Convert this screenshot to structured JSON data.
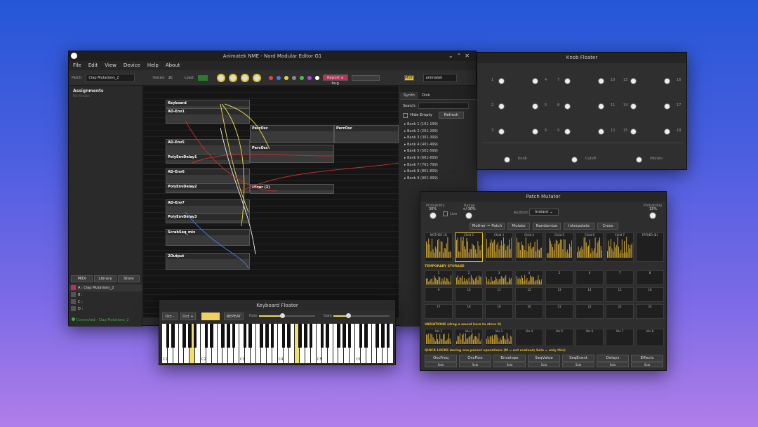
{
  "main": {
    "title": "Animatek NME - Nord Modular Editor G1",
    "menu": [
      "File",
      "Edit",
      "View",
      "Device",
      "Help",
      "About"
    ],
    "patch_label": "Patch:",
    "patch_name": "Clap Mutations_2",
    "voices_label": "Voices:",
    "voices_value": "2c",
    "load_label": "Load:",
    "report_btn": "Report a bug",
    "mst": "MST",
    "user": "animatek",
    "assignments": "Assignments",
    "assign_sub": "No Knobs",
    "left_tabs": [
      "MIDI",
      "Library",
      "Store"
    ],
    "slots": [
      {
        "id": "A",
        "name": "A : Clap Mutations_2"
      },
      {
        "id": "B",
        "name": "B :"
      },
      {
        "id": "C",
        "name": "C :"
      },
      {
        "id": "D",
        "name": "D :"
      }
    ],
    "status": "Connected - Clap Mutations_2",
    "right_tabs": [
      "Synth",
      "Disk"
    ],
    "search_label": "Search:",
    "hide_empty": "Hide Empty",
    "refresh": "Refresh",
    "banks": [
      "Bank 1 (101-199)",
      "Bank 2 (201-299)",
      "Bank 3 (301-399)",
      "Bank 4 (401-499)",
      "Bank 5 (501-599)",
      "Bank 6 (601-699)",
      "Bank 7 (701-799)",
      "Bank 8 (801-899)",
      "Bank 9 (901-999)"
    ],
    "modules": [
      "Keyboard",
      "AD-Env1",
      "AD-Env5",
      "PolyEnvDelay1",
      "AD-Env6",
      "PolyEnvDelay2",
      "AD-Env7",
      "PolyEnvDelay3",
      "PercOsc",
      "PercOsc",
      "PercOsc",
      "Mixer (2)",
      "ScrabSeq_mix",
      "2Output"
    ]
  },
  "knobs": {
    "title": "Knob Floater",
    "numbers": [
      "1",
      "4",
      "7",
      "10",
      "13",
      "16",
      "2",
      "5",
      "8",
      "11",
      "14",
      "17",
      "3",
      "6",
      "9",
      "12",
      "15",
      "18"
    ],
    "bottom": [
      "Knob",
      "Cutoff",
      "Vibrato"
    ]
  },
  "mut": {
    "title": "Patch Mutator",
    "probability_label": "Probability",
    "probability_value": "30%",
    "range_label": "Range",
    "range_value": "+/-30%",
    "live_label": "Live",
    "audition_label": "Audition",
    "audition_value": "Instant",
    "prob2_label": "Probability",
    "prob2_value": "15%",
    "buttons": [
      "Mother = Patch",
      "Mutate",
      "Randomize",
      "Interpolate",
      "Cross"
    ],
    "top_slots": [
      "MOTHER (1)",
      "Child 2",
      "Child 3",
      "Child 4",
      "Child 5",
      "Child 6",
      "Child 7",
      "FATHER (8)"
    ],
    "temp_label": "TEMPORARY STORAGE",
    "temp": [
      "1",
      "2",
      "3",
      "4",
      "5",
      "6",
      "7",
      "8",
      "9",
      "10",
      "11",
      "12",
      "13",
      "14",
      "15",
      "16",
      "17",
      "18",
      "19",
      "20",
      "21",
      "22",
      "23",
      "24"
    ],
    "var_label": "VARIATIONS  (drag a sound here to store it)",
    "vars": [
      "Var 1",
      "Var 2",
      "Var 3",
      "Var 4",
      "Var 5",
      "Var 6",
      "Var 7",
      "Var 8"
    ],
    "locks_label": "QUICK LOCKS during one-parent operations  (M = not evolved; Solo = only this)",
    "locks": [
      "OscFreq",
      "OscFine",
      "Envelope",
      "SeqValue",
      "SeqEvent",
      "Delays",
      "Effects"
    ],
    "solo": "Solo"
  },
  "kb": {
    "title": "Keyboard Floater",
    "oct_minus": "Oct -",
    "oct_plus": "Oct +",
    "repeat": "REPEAT",
    "rate": "Rate",
    "gate": "Gate",
    "octs": [
      "C1",
      "C2",
      "C3",
      "C4",
      "C5",
      "C6"
    ]
  }
}
